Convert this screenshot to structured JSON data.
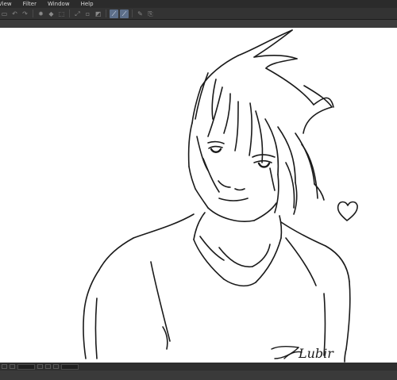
{
  "menubar": {
    "items": [
      {
        "label": "View"
      },
      {
        "label": "Filter"
      },
      {
        "label": "Window"
      },
      {
        "label": "Help"
      }
    ]
  },
  "toolbar": {
    "buttons": [
      {
        "icon": "new-icon",
        "glyph": "▭",
        "active": false
      },
      {
        "icon": "undo-icon",
        "glyph": "↶",
        "active": false
      },
      {
        "icon": "redo-icon",
        "glyph": "↷",
        "active": false
      },
      {
        "icon": "settings-icon",
        "glyph": "✹",
        "active": false
      },
      {
        "icon": "fill-icon",
        "glyph": "◆",
        "active": false
      },
      {
        "icon": "select-icon",
        "glyph": "⬚",
        "active": false
      },
      {
        "icon": "transform-icon",
        "glyph": "⤢",
        "active": false
      },
      {
        "icon": "deselect-icon",
        "glyph": "▫",
        "active": false
      },
      {
        "icon": "invert-icon",
        "glyph": "◩",
        "active": false
      },
      {
        "icon": "snap-ruler-icon",
        "glyph": "⟋",
        "active": true
      },
      {
        "icon": "snap-special-icon",
        "glyph": "⟋",
        "active": true
      },
      {
        "icon": "pen-icon",
        "glyph": "✎",
        "active": false
      },
      {
        "icon": "reference-icon",
        "glyph": "⎘",
        "active": false
      }
    ]
  },
  "canvas": {
    "signature_text": "Lubir",
    "colors": {
      "background": "#ffffff",
      "line": "#1a1a1a"
    }
  }
}
